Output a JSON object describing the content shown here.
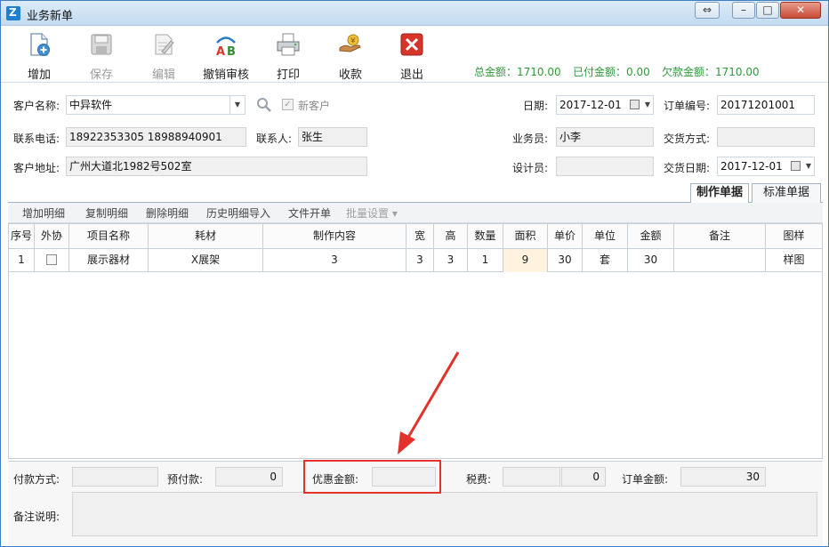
{
  "window": {
    "title": "业务新单",
    "controls": [
      "⇔",
      "–",
      "□",
      "✕"
    ]
  },
  "toolbar": {
    "buttons": [
      {
        "label": "增加",
        "icon": "new-document-icon",
        "enabled": true
      },
      {
        "label": "保存",
        "icon": "floppy-disk-icon",
        "enabled": false
      },
      {
        "label": "编辑",
        "icon": "edit-document-icon",
        "enabled": false
      },
      {
        "label": "撤销审核",
        "icon": "ab-review-icon",
        "enabled": true
      },
      {
        "label": "打印",
        "icon": "printer-icon",
        "enabled": true
      },
      {
        "label": "收款",
        "icon": "money-hand-icon",
        "enabled": true
      },
      {
        "label": "退出",
        "icon": "exit-x-icon",
        "enabled": true
      }
    ],
    "totals": {
      "total": "总金额：1710.00",
      "paid": "已付金额：0.00",
      "owed": "欠款金额：1710.00"
    }
  },
  "form": {
    "customer_label": "客户名称:",
    "customer_value": "中异软件",
    "new_customer_label": "新客户",
    "new_customer_checked": true,
    "phone_label": "联系电话:",
    "phone_value": "18922353305 18988940901",
    "contact_label": "联系人:",
    "contact_value": "张生",
    "address_label": "客户地址:",
    "address_value": "广州大道北1982号502室",
    "date_label": "日期:",
    "date_value": "2017-12-01",
    "order_no_label": "订单编号:",
    "order_no_value": "20171201001",
    "salesman_label": "业务员:",
    "salesman_value": "小李",
    "delivery_method_label": "交货方式:",
    "delivery_method_value": "",
    "designer_label": "设计员:",
    "designer_value": "",
    "delivery_date_label": "交货日期:",
    "delivery_date_value": "2017-12-01"
  },
  "tabs": [
    {
      "label": "制作单据",
      "active": true
    },
    {
      "label": "标准单据",
      "active": false
    }
  ],
  "detail_toolbar": [
    {
      "label": "增加明细",
      "enabled": true
    },
    {
      "label": "复制明细",
      "enabled": true
    },
    {
      "label": "删除明细",
      "enabled": true
    },
    {
      "label": "历史明细导入",
      "enabled": true
    },
    {
      "label": "文件开单",
      "enabled": true
    },
    {
      "label": "批量设置 ▾",
      "enabled": false
    }
  ],
  "grid": {
    "columns": [
      "序号",
      "外协",
      "项目名称",
      "耗材",
      "制作内容",
      "宽",
      "高",
      "数量",
      "面积",
      "单价",
      "单位",
      "金额",
      "备注",
      "图样"
    ],
    "rows": [
      [
        "1",
        "",
        "展示器材",
        "X展架",
        "3",
        "3",
        "3",
        "1",
        "9",
        "30",
        "套",
        "30",
        "",
        "样图"
      ]
    ]
  },
  "footer": {
    "payment_method_label": "付款方式:",
    "payment_method_value": "",
    "prepay_label": "预付款:",
    "prepay_value": "0",
    "discount_label": "优惠金额:",
    "discount_value": "",
    "tax_label": "税费:",
    "tax_value_1": "",
    "tax_value_2": "0",
    "order_amount_label": "订单金额:",
    "order_amount_value": "30",
    "notes_label": "备注说明:",
    "notes_value": ""
  },
  "colors": {
    "totals_green": "#2e9a3a",
    "annotation_red": "#e3322b",
    "title_bar": "#c3dbf1"
  }
}
